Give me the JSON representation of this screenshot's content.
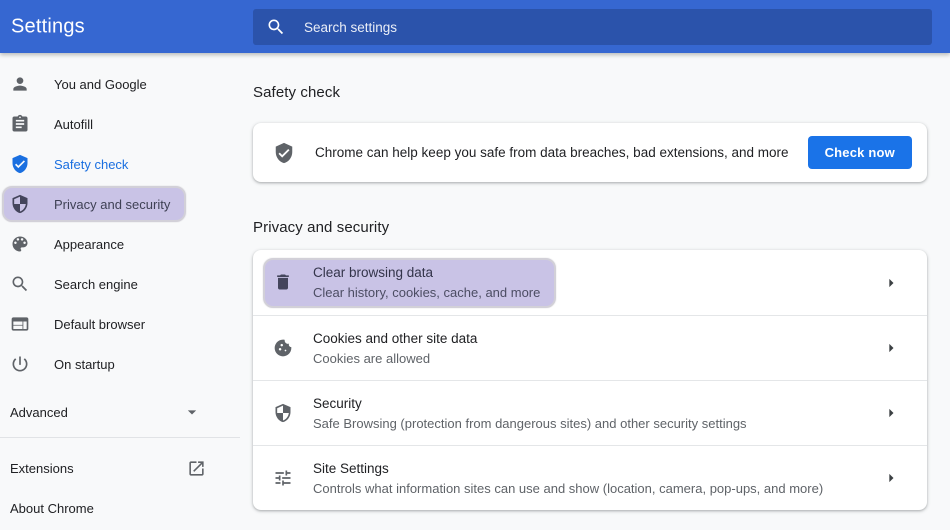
{
  "header": {
    "title": "Settings",
    "search_placeholder": "Search settings"
  },
  "sidebar": {
    "items": [
      {
        "label": "You and Google",
        "icon": "person-icon"
      },
      {
        "label": "Autofill",
        "icon": "autofill-clipboard-icon"
      },
      {
        "label": "Safety check",
        "icon": "safety-check-shield-icon",
        "active": true
      },
      {
        "label": "Privacy and security",
        "icon": "privacy-shield-icon",
        "highlighted": true
      },
      {
        "label": "Appearance",
        "icon": "palette-icon"
      },
      {
        "label": "Search engine",
        "icon": "search-icon"
      },
      {
        "label": "Default browser",
        "icon": "browser-window-icon"
      },
      {
        "label": "On startup",
        "icon": "power-icon"
      }
    ],
    "advanced_label": "Advanced",
    "extensions_label": "Extensions",
    "about_label": "About Chrome"
  },
  "safety_check": {
    "heading": "Safety check",
    "message": "Chrome can help keep you safe from data breaches, bad extensions, and more",
    "button_label": "Check now"
  },
  "privacy": {
    "heading": "Privacy and security",
    "rows": [
      {
        "title": "Clear browsing data",
        "subtitle": "Clear history, cookies, cache, and more",
        "icon": "trash-icon",
        "highlighted": true
      },
      {
        "title": "Cookies and other site data",
        "subtitle": "Cookies are allowed",
        "icon": "cookie-icon"
      },
      {
        "title": "Security",
        "subtitle": "Safe Browsing (protection from dangerous sites) and other security settings",
        "icon": "shield-icon"
      },
      {
        "title": "Site Settings",
        "subtitle": "Controls what information sites can use and show (location, camera, pop-ups, and more)",
        "icon": "tune-sliders-icon"
      }
    ]
  },
  "colors": {
    "header_blue": "#3667d1",
    "search_box_blue": "#2b53ab",
    "accent_blue": "#1a73e8",
    "active_nav_blue": "#1a6fe0",
    "highlight_lavender": "#c9c3e6",
    "icon_gray": "#5f6368",
    "text_primary": "#202124",
    "text_secondary": "#5f6368",
    "page_background": "#f8f9fa",
    "card_white": "#ffffff"
  }
}
